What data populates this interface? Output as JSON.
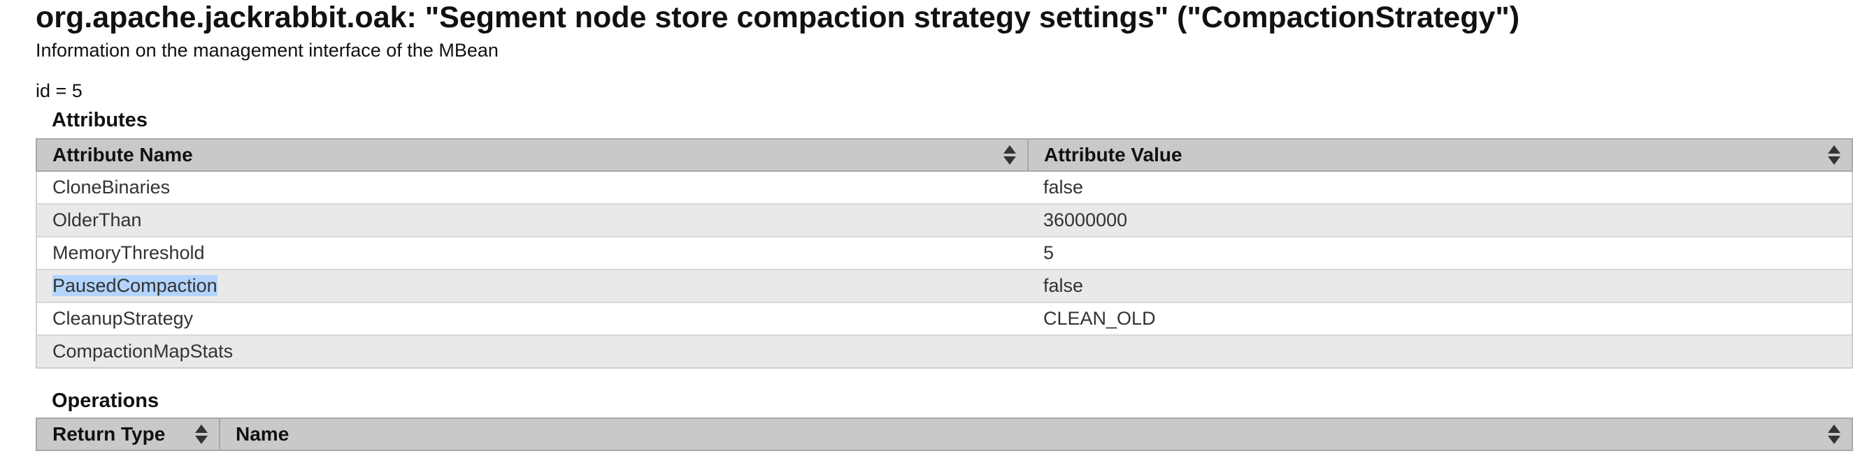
{
  "header": {
    "title": "org.apache.jackrabbit.oak: \"Segment node store compaction strategy settings\" (\"CompactionStrategy\")",
    "subtitle": "Information on the management interface of the MBean",
    "id_line": "id = 5"
  },
  "attributes": {
    "heading": "Attributes",
    "columns": [
      "Attribute Name",
      "Attribute Value"
    ],
    "rows": [
      {
        "name": "CloneBinaries",
        "value": "false"
      },
      {
        "name": "OlderThan",
        "value": "36000000"
      },
      {
        "name": "MemoryThreshold",
        "value": "5"
      },
      {
        "name": "PausedCompaction",
        "value": "false"
      },
      {
        "name": "CleanupStrategy",
        "value": "CLEAN_OLD"
      },
      {
        "name": "CompactionMapStats",
        "value": ""
      }
    ]
  },
  "operations": {
    "heading": "Operations",
    "columns": [
      "Return Type",
      "Name"
    ]
  },
  "icons": {
    "sort": "sort-updown-icon"
  },
  "colors": {
    "header_bg": "#c9c9c9",
    "row_alt": "#e9e9e9",
    "selection": "#b3d4fc"
  }
}
